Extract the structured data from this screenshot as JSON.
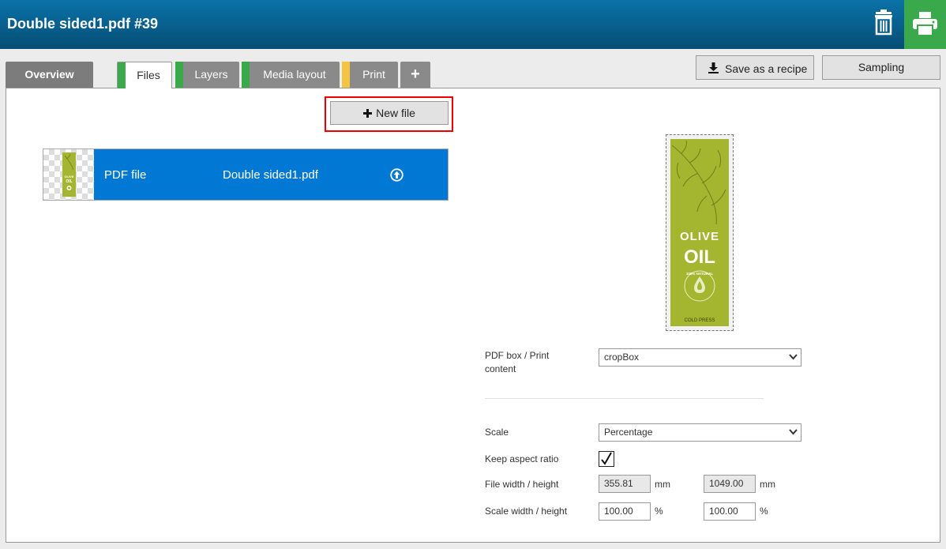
{
  "header": {
    "title": "Double sided1.pdf #39"
  },
  "tabs": {
    "overview": "Overview",
    "files": {
      "label": "Files",
      "color": "#3aa94c"
    },
    "layers": {
      "label": "Layers",
      "color": "#3aa94c"
    },
    "media_layout": {
      "label": "Media layout",
      "color": "#3aa94c"
    },
    "print": {
      "label": "Print",
      "color": "#f5c542"
    },
    "add": "+"
  },
  "toolbar": {
    "save_recipe": "Save as a recipe",
    "sampling": "Sampling"
  },
  "files": {
    "new_file": "New file",
    "items": [
      {
        "type": "PDF file",
        "name": "Double sided1.pdf"
      }
    ]
  },
  "preview": {
    "line1": "OLIVE",
    "line2": "OIL",
    "badge": "100% NATURAL",
    "footer": "COLD PRESS"
  },
  "settings": {
    "pdf_box_label": "PDF box / Print content",
    "pdf_box_value": "cropBox",
    "scale_label": "Scale",
    "scale_value": "Percentage",
    "keep_aspect_label": "Keep aspect ratio",
    "keep_aspect_checked": true,
    "file_size_label": "File width / height",
    "file_width": "355.81",
    "file_height": "1049.00",
    "file_unit": "mm",
    "scale_size_label": "Scale width / height",
    "scale_width": "100.00",
    "scale_height": "100.00",
    "scale_unit": "%"
  },
  "colors": {
    "header_top": "#0a72a8",
    "header_bottom": "#064e75",
    "print_button": "#3aa94c",
    "file_row": "#0078d4",
    "highlight": "#e00000"
  }
}
